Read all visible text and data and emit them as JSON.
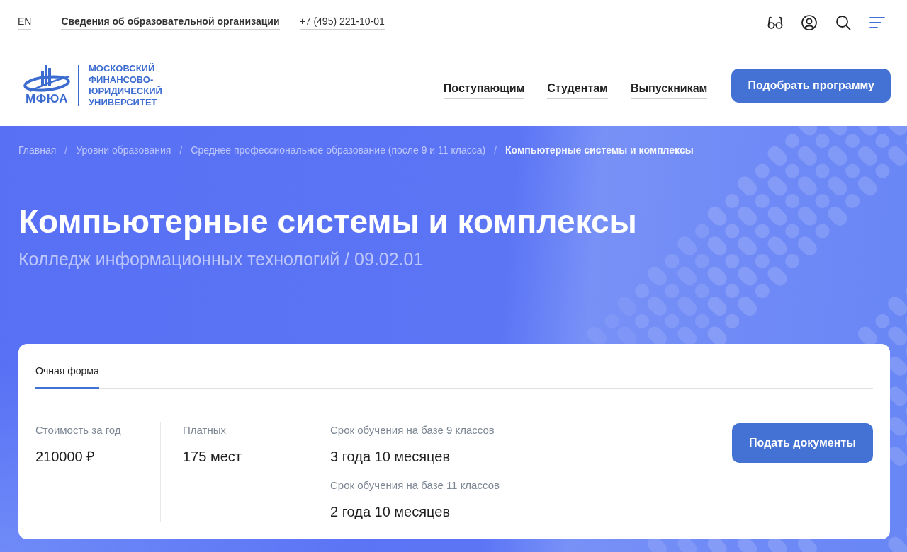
{
  "top_bar": {
    "language": "EN",
    "links": [
      {
        "label": "Сведения об образовательной организации",
        "kind": "info"
      },
      {
        "label": "+7 (495) 221-10-01",
        "kind": "phone"
      }
    ]
  },
  "header": {
    "logo": {
      "abbreviation": "МФЮА",
      "name_lines": [
        "МОСКОВСКИЙ",
        "ФИНАНСОВО-",
        "ЮРИДИЧЕСКИЙ",
        "УНИВЕРСИТЕТ"
      ]
    },
    "nav": [
      "Поступающим",
      "Студентам",
      "Выпускникам"
    ],
    "cta_button": "Подобрать программу"
  },
  "hero": {
    "breadcrumbs": [
      {
        "label": "Главная",
        "current": false,
        "separator": "/"
      },
      {
        "label": "Уровни образования",
        "current": false,
        "separator": "/"
      },
      {
        "label": "Среднее профессиональное образование (после 9 и 11 класса)",
        "current": false,
        "separator": "/"
      },
      {
        "label": "Компьютерные системы и комплексы",
        "current": true
      }
    ],
    "title": "Компьютерные системы и комплексы",
    "subtitle": "Колледж информационных технологий / 09.02.01"
  },
  "program_card": {
    "tabs": [
      {
        "label": "Очная форма",
        "selected": true
      }
    ],
    "stats": [
      {
        "rows": [
          {
            "label": "Стоимость за год",
            "value": "210000 ₽"
          }
        ]
      },
      {
        "rows": [
          {
            "label": "Платных",
            "value": "175 мест"
          }
        ]
      },
      {
        "rows": [
          {
            "label": "Срок обучения на базе 9 классов",
            "value": "3 года 10 месяцев"
          },
          {
            "label": "Срок обучения на базе 11 классов",
            "value": "2 года 10 месяцев"
          }
        ]
      }
    ],
    "apply_button": "Подать документы"
  }
}
